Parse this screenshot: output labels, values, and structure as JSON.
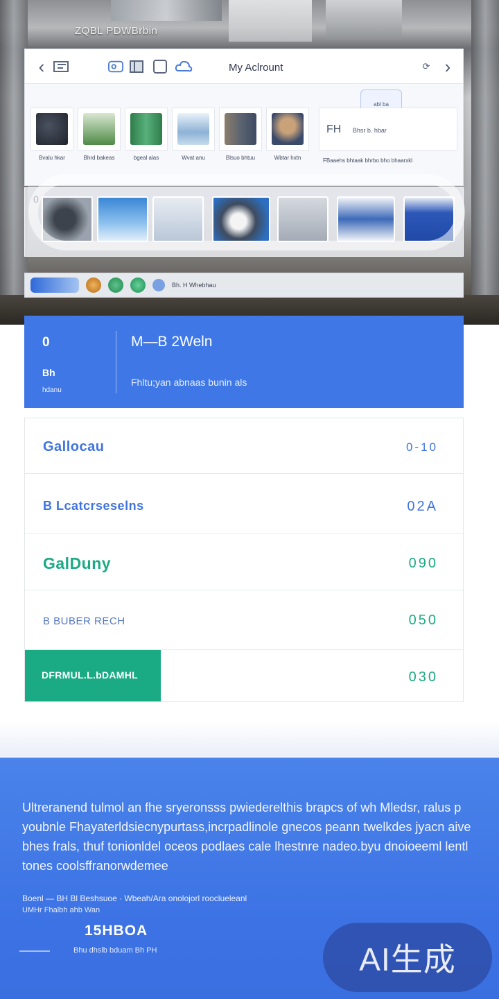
{
  "hero": {
    "caption": "ZQBL PDWBrbin"
  },
  "browser": {
    "back_glyph": "‹",
    "forward_glyph": "›",
    "title": "My Aclrount",
    "tooltip": "abl ba",
    "thumbs": [
      {
        "label": "Bvalu hkar",
        "color": "#2f3440"
      },
      {
        "label": "Bhrd bakeas",
        "color": "#4f8a47"
      },
      {
        "label": "bgeal alas",
        "color": "#2e7d4a"
      },
      {
        "label": "Wvat anu",
        "color": "#8cb2d6"
      },
      {
        "label": "Blsuo bhtuu",
        "color": "#5b6470"
      },
      {
        "label": "Wbtar hxtn",
        "color": "#c9a27a"
      }
    ],
    "wide_panel": {
      "glyph": "FH",
      "text": "Bhsr b. hbar",
      "label": "FBaaehs bhtaak bhrbo bho bhaarxkl"
    }
  },
  "strip": {
    "index": "0",
    "bar_text": "Bh. H Whebhau"
  },
  "header_card": {
    "code": "0",
    "sub": "Bh",
    "sub2": "hdanu",
    "title": "M—B 2Weln",
    "desc": "Fhltu;yan abnaas bunin als"
  },
  "list": {
    "rows": [
      {
        "label": "Gallocau",
        "value": "0-10",
        "label_color": "#3f73e0",
        "value_color": "#3f73e0"
      },
      {
        "label": "B Lcatcrseselns",
        "value": "02A",
        "label_color": "#3f73e0",
        "value_color": "#3f73e0"
      },
      {
        "label": "GalDuny",
        "value": "090",
        "label_color": "#1aaa84",
        "value_color": "#1aaa84"
      },
      {
        "label": "B BUBER RECH",
        "value": "050",
        "label_color": "#5577c4",
        "value_color": "#1aaa84"
      },
      {
        "label": "DFRMUL.L.bDAMHL",
        "value": "030",
        "label_color": "#ffffff",
        "value_color": "#1aaa84"
      }
    ]
  },
  "footer": {
    "paragraph": "Ultreranend tulmol an fhe sryeronsss pwiederelthis brapcs of wh Mledsr, ralus p youbnle Fhayaterldsiecnypurtass,incrpadlinole gnecos peann twelkdes jyacn aive bhes frals, thuf tonionldel oceos podlaes cale lhestnre nadeo.byu dnoioeeml lentl tones coolsffranorwdemee",
    "meta": "Boenl — BH Bl Beshsuoe · Wbeah/Ara onolojorl rooclueleanl",
    "meta2": "UMHr Fhalbh ahb Wan",
    "number": "15HBOA",
    "foot": "Bhu dhslb bduam Bh PH"
  },
  "badge": "AI生成"
}
